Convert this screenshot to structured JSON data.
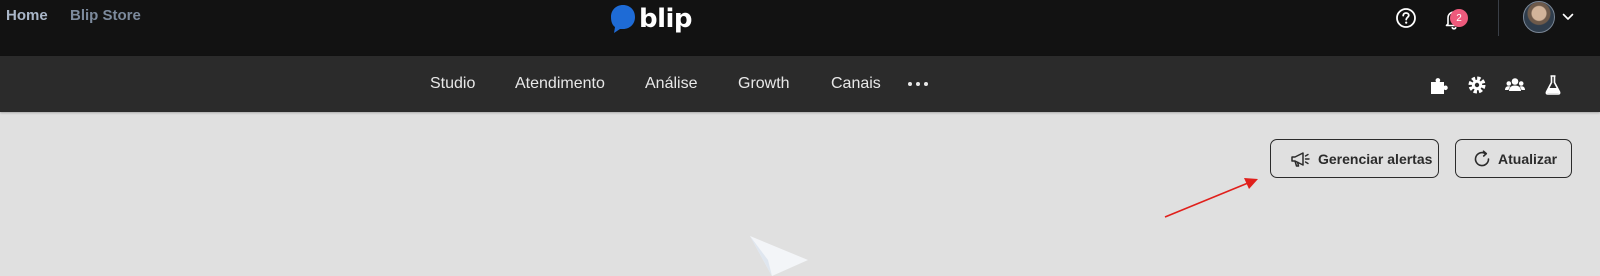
{
  "topbar": {
    "home_label": "Home",
    "store_label": "Blip Store",
    "logo_text": "blip",
    "notification_count": "2",
    "icons": [
      "help-icon",
      "bell-icon",
      "avatar",
      "chevron-down-icon"
    ]
  },
  "navbar": {
    "items": [
      "Studio",
      "Atendimento",
      "Análise",
      "Growth",
      "Canais"
    ],
    "more_icon": "more-dots-icon",
    "right_icons": [
      "puzzle-icon",
      "gear-icon",
      "team-icon",
      "flask-icon"
    ]
  },
  "actions": {
    "alerts_label": "Gerenciar alertas",
    "alerts_icon": "megaphone-icon",
    "refresh_label": "Atualizar",
    "refresh_icon": "refresh-icon"
  },
  "colors": {
    "topbar_bg": "#121212",
    "navbar_bg": "#2b2b2b",
    "content_bg": "#e0e0e0",
    "logo_blue": "#1e6bd6",
    "badge": "#ee5a7c",
    "annotation_arrow": "#e0201c"
  }
}
